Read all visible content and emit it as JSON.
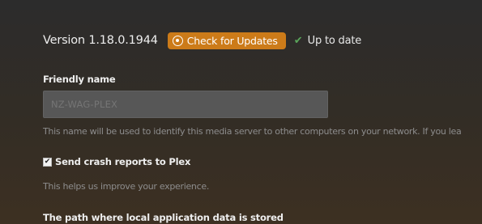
{
  "version": {
    "text": "Version 1.18.0.1944",
    "update_button_label": "Check for Updates",
    "update_icon": "update-circle-icon",
    "status_icon": "checkmark-icon",
    "status_text": "Up to date"
  },
  "friendly_name": {
    "label": "Friendly name",
    "value": "",
    "placeholder": "NZ-WAG-PLEX",
    "help": "This name will be used to identify this media server to other computers on your network. If you lea"
  },
  "crash_reports": {
    "checked": true,
    "check_mark": "✔",
    "label": "Send crash reports to Plex",
    "help": "This helps us improve your experience."
  },
  "app_data_path": {
    "label": "The path where local application data is stored"
  },
  "colors": {
    "accent": "#cc7b19",
    "success": "#5aa55a"
  }
}
